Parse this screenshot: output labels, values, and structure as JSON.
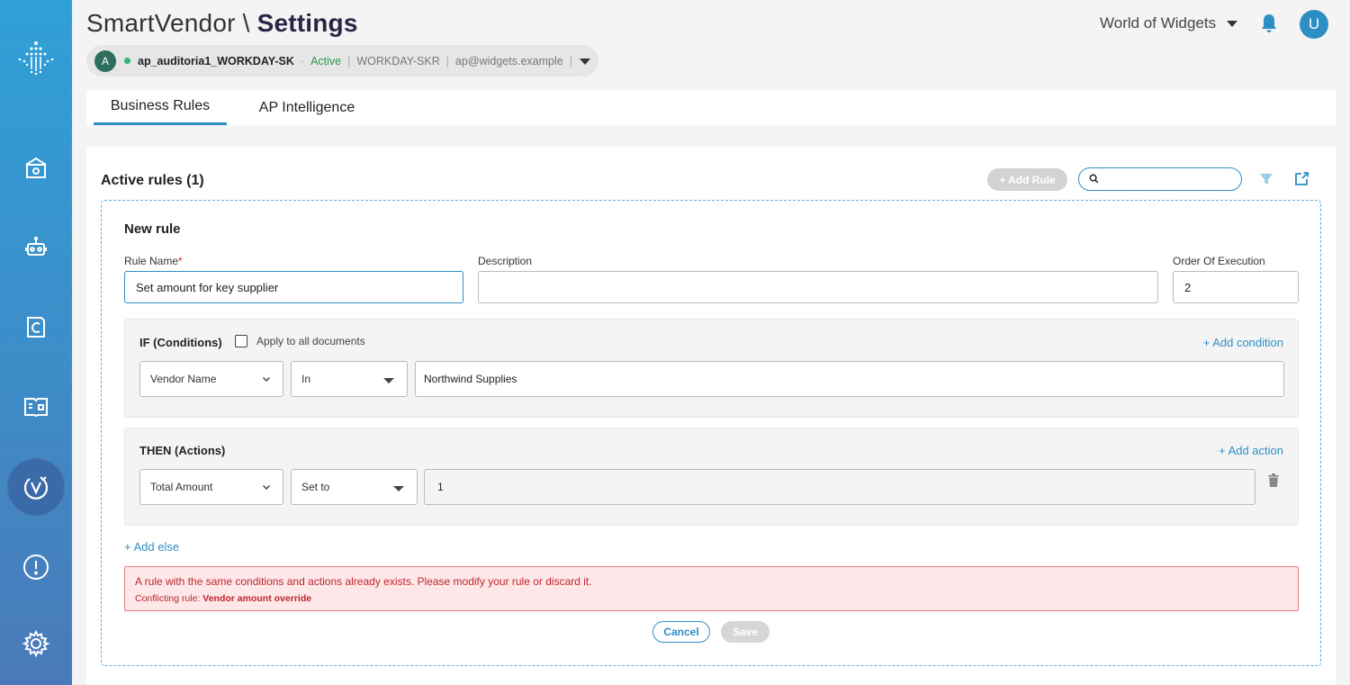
{
  "header": {
    "app_name": "SmartVendor",
    "separator": "\\",
    "page": "Settings",
    "org": "World of Widgets",
    "user_initial": "U"
  },
  "connection": {
    "avatar_initial": "A",
    "name": "ap_auditoria1_WORKDAY-SK",
    "status": "Active",
    "system": "WORKDAY-SKR",
    "email": "ap@widgets.example",
    "dot_color": "#2eb872"
  },
  "sidebar": {
    "items": [
      {
        "icon": "bank-icon"
      },
      {
        "icon": "robot-icon"
      },
      {
        "icon": "contract-icon"
      },
      {
        "icon": "book-icon"
      },
      {
        "icon": "rules-v-icon",
        "active": true
      },
      {
        "icon": "alert-icon"
      },
      {
        "icon": "settings-icon"
      }
    ]
  },
  "tabs": [
    {
      "label": "Business Rules",
      "active": true
    },
    {
      "label": "AP Intelligence",
      "active": false
    }
  ],
  "rules": {
    "title": "Active rules (1)",
    "add_rule_label": "+ Add Rule",
    "search_placeholder": ""
  },
  "new_rule": {
    "title": "New rule",
    "name_label": "Rule Name",
    "required_mark": "*",
    "name_value": "Set amount for key supplier",
    "description_label": "Description",
    "description_value": "",
    "order_label": "Order Of Execution",
    "order_value": "2"
  },
  "conditions": {
    "title": "IF (Conditions)",
    "apply_all_label": "Apply to all documents",
    "apply_all_checked": false,
    "add_label": "+ Add condition",
    "field": "Vendor Name",
    "operator": "In",
    "value": "Northwind Supplies"
  },
  "actions": {
    "title": "THEN (Actions)",
    "add_label": "+ Add action",
    "field": "Total Amount",
    "operator": "Set to",
    "value": "1"
  },
  "add_else_label": "+ Add else",
  "error": {
    "message": "A rule with the same conditions and actions already exists. Please modify your rule or discard it.",
    "conflict_prefix": "Conflicting rule:",
    "conflict_rule": "Vendor amount override"
  },
  "buttons": {
    "cancel": "Cancel",
    "save": "Save"
  },
  "colors": {
    "accent": "#2d8ec4",
    "error": "#c0262d",
    "active_status": "#2a9a4a"
  }
}
